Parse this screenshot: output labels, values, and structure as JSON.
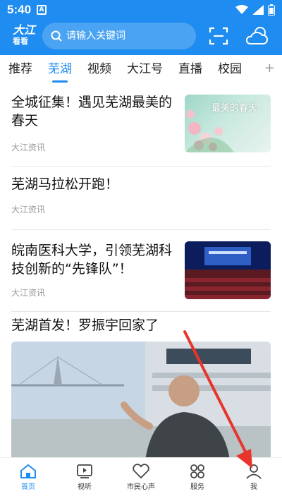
{
  "status": {
    "time": "5:40",
    "notif_badge": "A"
  },
  "header": {
    "logo_line1": "大江",
    "logo_line2": "看看",
    "search_placeholder": "请输入关键词",
    "scan_icon": "scan-icon",
    "weather_icon": "weather-cloud-sun-icon"
  },
  "tabs": [
    {
      "label": "推荐"
    },
    {
      "label": "芜湖"
    },
    {
      "label": "视频"
    },
    {
      "label": "大江号"
    },
    {
      "label": "直播"
    },
    {
      "label": "校园"
    }
  ],
  "active_tab": 1,
  "feed": [
    {
      "title": "全城征集！遇见芜湖最美的春天",
      "source": "大江资讯",
      "thumb_caption": "最美的春天。"
    },
    {
      "title": "芜湖马拉松开跑！",
      "source": "大江资讯"
    },
    {
      "title": "皖南医科大学，引领芜湖科技创新的“先锋队”！",
      "source": "大江资讯"
    },
    {
      "title": "芜湖首发！罗振宇回家了"
    }
  ],
  "nav": [
    {
      "label": "首页",
      "icon": "home-icon"
    },
    {
      "label": "视听",
      "icon": "video-play-icon"
    },
    {
      "label": "市民心声",
      "icon": "heart-icon"
    },
    {
      "label": "服务",
      "icon": "services-grid-icon"
    },
    {
      "label": "我",
      "icon": "user-icon"
    }
  ],
  "colors": {
    "brand": "#1e8cf0",
    "annotation_arrow": "#e8352b"
  }
}
